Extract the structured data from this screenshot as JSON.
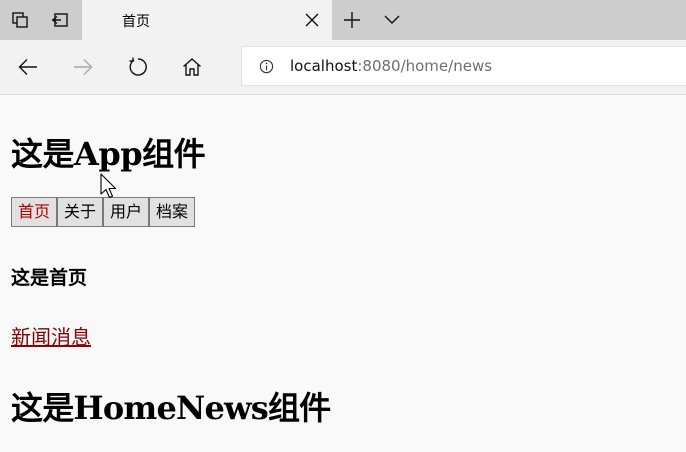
{
  "browser": {
    "tab_title": "首页",
    "url_host": "localhost",
    "url_rest": ":8080/home/news"
  },
  "app": {
    "title": "这是App组件",
    "buttons": [
      {
        "label": "首页",
        "active": true
      },
      {
        "label": "关于",
        "active": false
      },
      {
        "label": "用户",
        "active": false
      },
      {
        "label": "档案",
        "active": false
      }
    ]
  },
  "home": {
    "heading": "这是首页",
    "news_link": "新闻消息"
  },
  "home_news": {
    "title": "这是HomeNews组件"
  },
  "colors": {
    "active_button_text": "#b00000",
    "link": "#8b0000"
  }
}
